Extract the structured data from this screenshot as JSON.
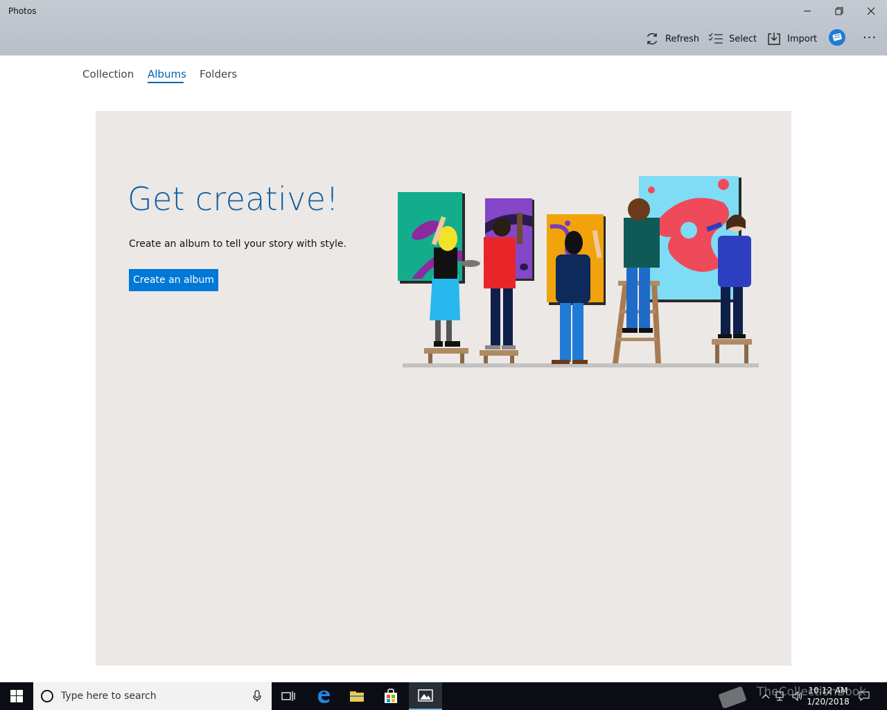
{
  "window": {
    "title": "Photos"
  },
  "toolbar": {
    "refresh_label": "Refresh",
    "select_label": "Select",
    "import_label": "Import",
    "more_label": "···"
  },
  "tabs": [
    {
      "label": "Collection",
      "active": false
    },
    {
      "label": "Albums",
      "active": true
    },
    {
      "label": "Folders",
      "active": false
    }
  ],
  "hero": {
    "title": "Get creative!",
    "subtitle": "Create an album to tell your story with style.",
    "button_label": "Create an album"
  },
  "taskbar": {
    "search_placeholder": "Type here to search",
    "time": "10:12 AM",
    "date": "1/20/2018",
    "watermark": "TheCollectionBook"
  },
  "colors": {
    "accent": "#0078d7",
    "tab_active": "#0063b1",
    "hero_bg": "#ece8e6",
    "hero_title": "#0f5fa0"
  },
  "icons": [
    "refresh-icon",
    "select-icon",
    "import-icon",
    "story-remix-icon",
    "more-icon",
    "windows-logo-icon",
    "cortana-icon",
    "microphone-icon",
    "task-view-icon",
    "edge-icon",
    "file-explorer-icon",
    "store-icon",
    "photos-icon"
  ]
}
